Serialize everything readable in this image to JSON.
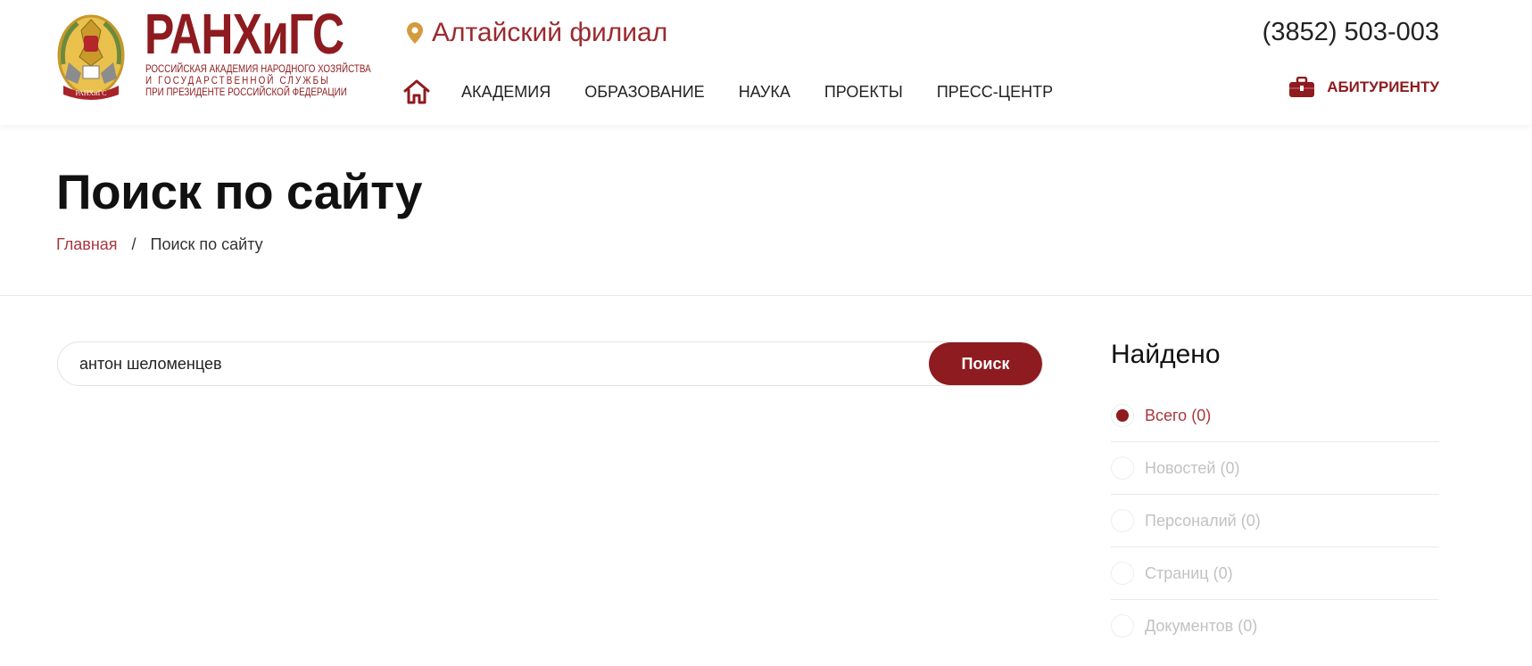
{
  "brand": {
    "name": "РАНХиГС",
    "subtitle": [
      "Российская академия народного хозяйства",
      "и государственной службы",
      "при Президенте Российской Федерации"
    ],
    "emblem_text": "РАНХиГС",
    "accent_color": "#8e1b1f"
  },
  "header": {
    "branch": "Алтайский филиал",
    "phone": "(3852) 503-003",
    "nav": [
      "АКАДЕМИЯ",
      "ОБРАЗОВАНИЕ",
      "НАУКА",
      "ПРОЕКТЫ",
      "ПРЕСС-ЦЕНТР"
    ],
    "home_icon": "home-icon",
    "applicant_label": "АБИТУРИЕНТУ",
    "applicant_icon": "briefcase-icon"
  },
  "page": {
    "title": "Поиск по сайту",
    "breadcrumb": {
      "home": "Главная",
      "separator": "/",
      "current": "Поиск по сайту"
    }
  },
  "search": {
    "value": "антон шеломенцев",
    "button_label": "Поиск"
  },
  "found": {
    "title": "Найдено",
    "filters": [
      {
        "label": "Всего (0)",
        "selected": true
      },
      {
        "label": "Новостей (0)",
        "selected": false
      },
      {
        "label": "Персоналий (0)",
        "selected": false
      },
      {
        "label": "Страниц (0)",
        "selected": false
      },
      {
        "label": "Документов (0)",
        "selected": false
      }
    ]
  }
}
